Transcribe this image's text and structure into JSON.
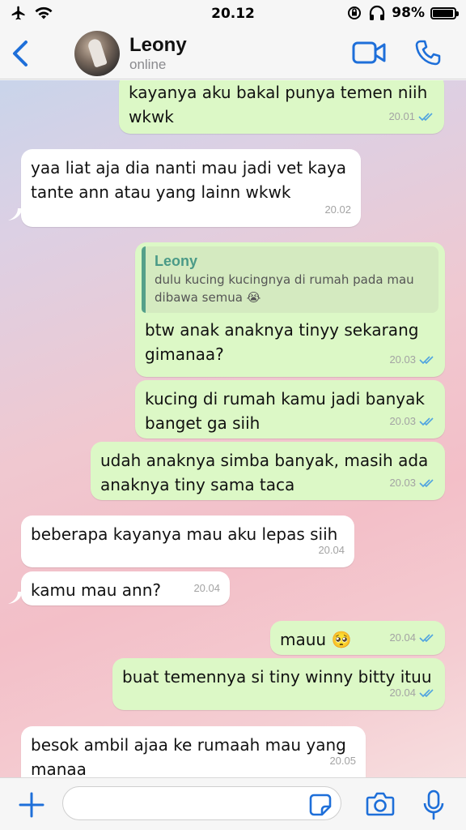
{
  "status_bar": {
    "time": "20.12",
    "battery": "98%"
  },
  "header": {
    "contact_name": "Leony",
    "contact_status": "online"
  },
  "messages": [
    {
      "direction": "out",
      "text_lines": [
        "kayanya aku bakal punya temen niih",
        "wkwk"
      ],
      "time": "20.01",
      "read": true
    },
    {
      "direction": "in",
      "text_lines": [
        "yaa liat aja dia nanti mau jadi vet kaya",
        "tante ann atau yang lainn wkwk"
      ],
      "time": "20.02"
    },
    {
      "direction": "out",
      "quote": {
        "name": "Leony",
        "text_lines": [
          "dulu kucing kucingnya di rumah pada mau",
          "dibawa semua 😭"
        ]
      },
      "text_lines": [
        "btw anak anaknya tinyy sekarang",
        "gimanaa?"
      ],
      "time": "20.03",
      "read": true
    },
    {
      "direction": "out",
      "text_lines": [
        "kucing di rumah kamu jadi banyak",
        "banget ga siih"
      ],
      "time": "20.03",
      "read": true
    },
    {
      "direction": "out",
      "text_lines": [
        "udah anaknya simba banyak, masih ada",
        "anaknya tiny sama taca"
      ],
      "time": "20.03",
      "read": true
    },
    {
      "direction": "in",
      "text_lines": [
        "beberapa kayanya mau aku lepas siih"
      ],
      "time": "20.04"
    },
    {
      "direction": "in",
      "text_lines": [
        "kamu mau ann?"
      ],
      "time": "20.04"
    },
    {
      "direction": "out",
      "text_lines": [
        "mauu 🥺"
      ],
      "time": "20.04",
      "read": true
    },
    {
      "direction": "out",
      "text_lines": [
        "buat temennya si tiny winny bitty ituu"
      ],
      "time": "20.04",
      "read": true
    },
    {
      "direction": "in",
      "text_lines": [
        "besok ambil ajaa ke rumaah mau yang",
        "manaa"
      ],
      "time": "20.05"
    }
  ],
  "input": {
    "value": "",
    "placeholder": ""
  },
  "colors": {
    "accent": "#1e6fd9",
    "outgoing_bubble": "#dcf8c6",
    "incoming_bubble": "#ffffff",
    "read_ticks": "#4fa3e0",
    "quote_name": "#4a9a87"
  },
  "icons": {
    "back": "chevron-left-icon",
    "video": "video-camera-icon",
    "call": "phone-icon",
    "plus": "plus-icon",
    "sticker": "sticker-icon",
    "camera": "camera-icon",
    "mic": "microphone-icon"
  }
}
